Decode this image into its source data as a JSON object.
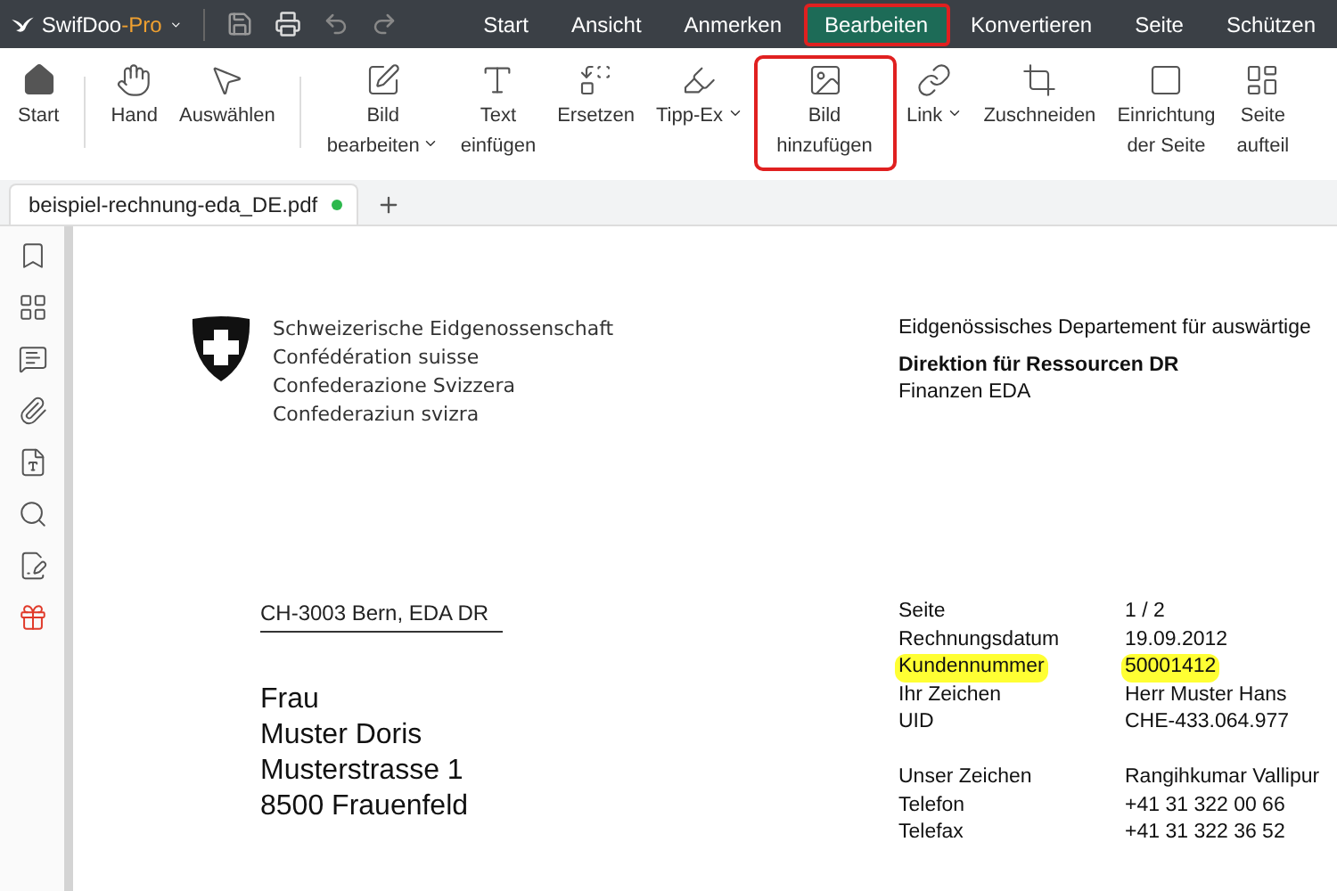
{
  "app": {
    "name": "SwifDoo",
    "suffix": "-Pro"
  },
  "menu": [
    {
      "label": "Start",
      "selected": false
    },
    {
      "label": "Ansicht",
      "selected": false
    },
    {
      "label": "Anmerken",
      "selected": false
    },
    {
      "label": "Bearbeiten",
      "selected": true
    },
    {
      "label": "Konvertieren",
      "selected": false
    },
    {
      "label": "Seite",
      "selected": false
    },
    {
      "label": "Schützen",
      "selected": false
    }
  ],
  "toolbar": [
    {
      "lines": [
        "Start"
      ],
      "dropdown": false,
      "highlighted": false
    },
    {
      "kind": "separator"
    },
    {
      "lines": [
        "Hand"
      ],
      "dropdown": false,
      "highlighted": false
    },
    {
      "lines": [
        "Auswählen"
      ],
      "dropdown": false,
      "highlighted": false
    },
    {
      "kind": "separator"
    },
    {
      "lines": [
        "Bild",
        "bearbeiten"
      ],
      "dropdown": true,
      "highlighted": false
    },
    {
      "lines": [
        "Text",
        "einfügen"
      ],
      "dropdown": false,
      "highlighted": false
    },
    {
      "lines": [
        "Ersetzen"
      ],
      "dropdown": false,
      "highlighted": false
    },
    {
      "lines": [
        "Tipp-Ex"
      ],
      "dropdown": true,
      "highlighted": false
    },
    {
      "lines": [
        "Bild",
        "hinzufügen"
      ],
      "dropdown": false,
      "highlighted": true
    },
    {
      "lines": [
        "Link"
      ],
      "dropdown": true,
      "highlighted": false
    },
    {
      "lines": [
        "Zuschneiden"
      ],
      "dropdown": false,
      "highlighted": false
    },
    {
      "lines": [
        "Einrichtung",
        "der Seite"
      ],
      "dropdown": false,
      "highlighted": false
    },
    {
      "lines": [
        "Seite",
        "aufteil"
      ],
      "dropdown": false,
      "highlighted": false
    }
  ],
  "tabs": [
    {
      "label": "beispiel-rechnung-eda_DE.pdf",
      "selected": true,
      "modified": true
    }
  ],
  "document": {
    "coat_lines": [
      "Schweizerische Eidgenossenschaft",
      "Confédération suisse",
      "Confederazione Svizzera",
      "Confederaziun svizra"
    ],
    "department": "Eidgenössisches Departement für auswärtige",
    "directorate": "Direktion für Ressourcen DR",
    "unit": "Finanzen EDA",
    "sender_line": "CH-3003 Bern, EDA DR",
    "recipient": [
      "Frau",
      "Muster Doris",
      "Musterstrasse 1",
      "8500 Frauenfeld"
    ],
    "details": [
      {
        "label": "Seite",
        "value": "1 / 2",
        "highlighted": false
      },
      {
        "label": "Rechnungsdatum",
        "value": "19.09.2012",
        "highlighted": false
      },
      {
        "label": "Kundennummer",
        "value": "50001412",
        "highlighted": true
      },
      {
        "label": "Ihr Zeichen",
        "value": "Herr Muster Hans",
        "highlighted": false
      },
      {
        "label": "UID",
        "value": "CHE-433.064.977",
        "highlighted": false
      }
    ],
    "contact": [
      {
        "label": "Unser Zeichen",
        "value": "Rangihkumar Vallipur",
        "highlighted": false
      },
      {
        "label": "Telefon",
        "value": "+41 31 322 00 66",
        "highlighted": false
      },
      {
        "label": "Telefax",
        "value": "+41 31 322 36 52",
        "highlighted": false
      }
    ]
  }
}
